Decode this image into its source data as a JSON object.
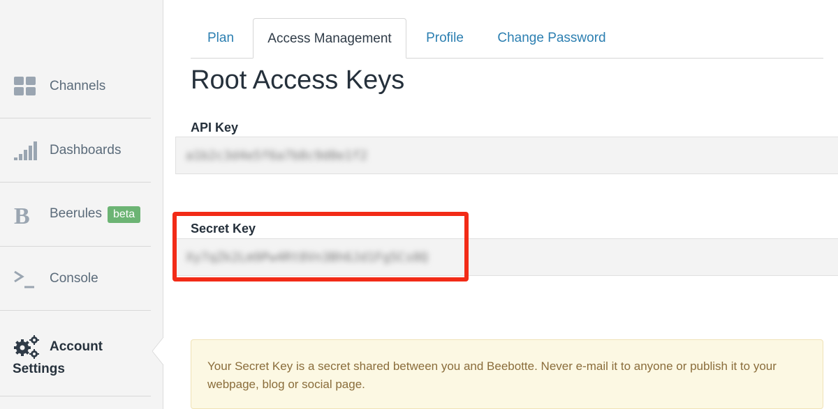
{
  "sidebar": {
    "items": [
      {
        "label": "Channels",
        "icon": "grid-icon"
      },
      {
        "label": "Dashboards",
        "icon": "signal-bars-icon"
      },
      {
        "label": "Beerules",
        "icon": "beerules-logo-icon",
        "badge": "beta"
      },
      {
        "label": "Console",
        "icon": "terminal-icon"
      }
    ],
    "account": {
      "label_line1": "Account",
      "label_line2": "Settings",
      "icon": "gears-icon"
    }
  },
  "tabs": [
    "Plan",
    "Access Management",
    "Profile",
    "Change Password"
  ],
  "active_tab": "Access Management",
  "page_title": "Root Access Keys",
  "api_key": {
    "label": "API Key",
    "value": "a1b2c3d4e5f6a7b8c9d0e1f2"
  },
  "secret_key": {
    "label": "Secret Key",
    "value": "Xy7qZk2Lm9Pw4Rt8Vn3Bh6Jd1Fg5Cs0Q"
  },
  "notice": "Your Secret Key is a secret shared between you and Beebotte. Never e-mail it to anyone or publish it to your webpage, blog or social page.",
  "colors": {
    "accent": "#2c7fb1",
    "highlight": "#f22b17",
    "badge": "#6cb474",
    "alert_bg": "#fcf8e3"
  }
}
